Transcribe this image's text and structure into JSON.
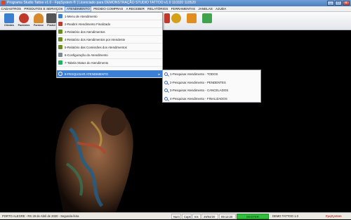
{
  "window": {
    "title": "Programa Studio Tattoo v1.0 - FpqSystem ® | Licenciado para DEMONSTRAÇÃO STUDIO TATTOO v1.0 110320 110520",
    "minimize": "_",
    "maximize": "□",
    "close": "x"
  },
  "menubar": {
    "items": [
      "CADASTROS",
      "PRODUTOS E SERVIÇOS",
      "ATENDIMENTO",
      "PEDIDO COMPRAS",
      "A RECEBER",
      "RELATÓRIOS",
      "FERRAMENTAS",
      "JANELAS",
      "AJUDA"
    ]
  },
  "toolbar": {
    "buttons": [
      {
        "label": "Clientes",
        "icon": "clients-icon",
        "color": "#3a7fd0"
      },
      {
        "label": "Pacientes",
        "icon": "patients-icon",
        "color": "#c0392b"
      },
      {
        "label": "Fornece",
        "icon": "supplier-icon",
        "color": "#d68a2c"
      },
      {
        "label": "Produt",
        "icon": "products-icon",
        "color": "#555"
      }
    ],
    "right_icons": [
      {
        "icon": "cash-icon",
        "color": "#c0392b"
      },
      {
        "icon": "coin-icon",
        "color": "#d4a017"
      },
      {
        "icon": "calculator-icon",
        "color": "#e08e20"
      },
      {
        "icon": "exit-icon",
        "color": "#3fa34d"
      }
    ]
  },
  "dropdown": {
    "items": [
      {
        "label": "1-Menu de Atendimento",
        "icon": "menu-icon",
        "color": "#3a7fd0"
      },
      {
        "label": "2-Reabrir Atendimento Finalizado",
        "icon": "reopen-icon",
        "color": "#c0392b"
      },
      {
        "label": "3-Relatório dos Atendimentos",
        "icon": "report-icon",
        "color": "#6b8e23"
      },
      {
        "label": "4-Relatório dos Atendimentos por Atendente",
        "icon": "report-icon",
        "color": "#6b8e23"
      },
      {
        "label": "5-Relatório das Comissões dos Atendimentos",
        "icon": "report-icon",
        "color": "#6b8e23"
      },
      {
        "label": "6-Configuração do Atendimento",
        "icon": "settings-icon",
        "color": "#7f8c8d"
      },
      {
        "label": "7-Tabela Status do Atendimento",
        "icon": "table-icon",
        "color": "#27ae60"
      },
      {
        "label": "8-PESQUISAR ATENDIMENTO",
        "icon": "search-icon",
        "color": "#ffffff"
      }
    ]
  },
  "submenu": {
    "items": [
      {
        "label": "1-Pesquisar Atendimento - TODOS"
      },
      {
        "label": "2-Pesquisar Atendimento - PENDENTES"
      },
      {
        "label": "3-Pesquisar Atendimento - CANCELADOS"
      },
      {
        "label": "4-Pesquisar Atendimento - FINALIZADOS"
      }
    ]
  },
  "statusbar": {
    "location": "PORTO ALEGRE - RS 29 de Abril de 2020 - Segunda-feira",
    "num": "Num",
    "caps": "Caps",
    "ins": "Ins",
    "date": "29/04/20",
    "time": "09:13:20",
    "master": "MASTER",
    "product": "DEMO TATTOO 1.0",
    "brand": "FpqSystem"
  }
}
